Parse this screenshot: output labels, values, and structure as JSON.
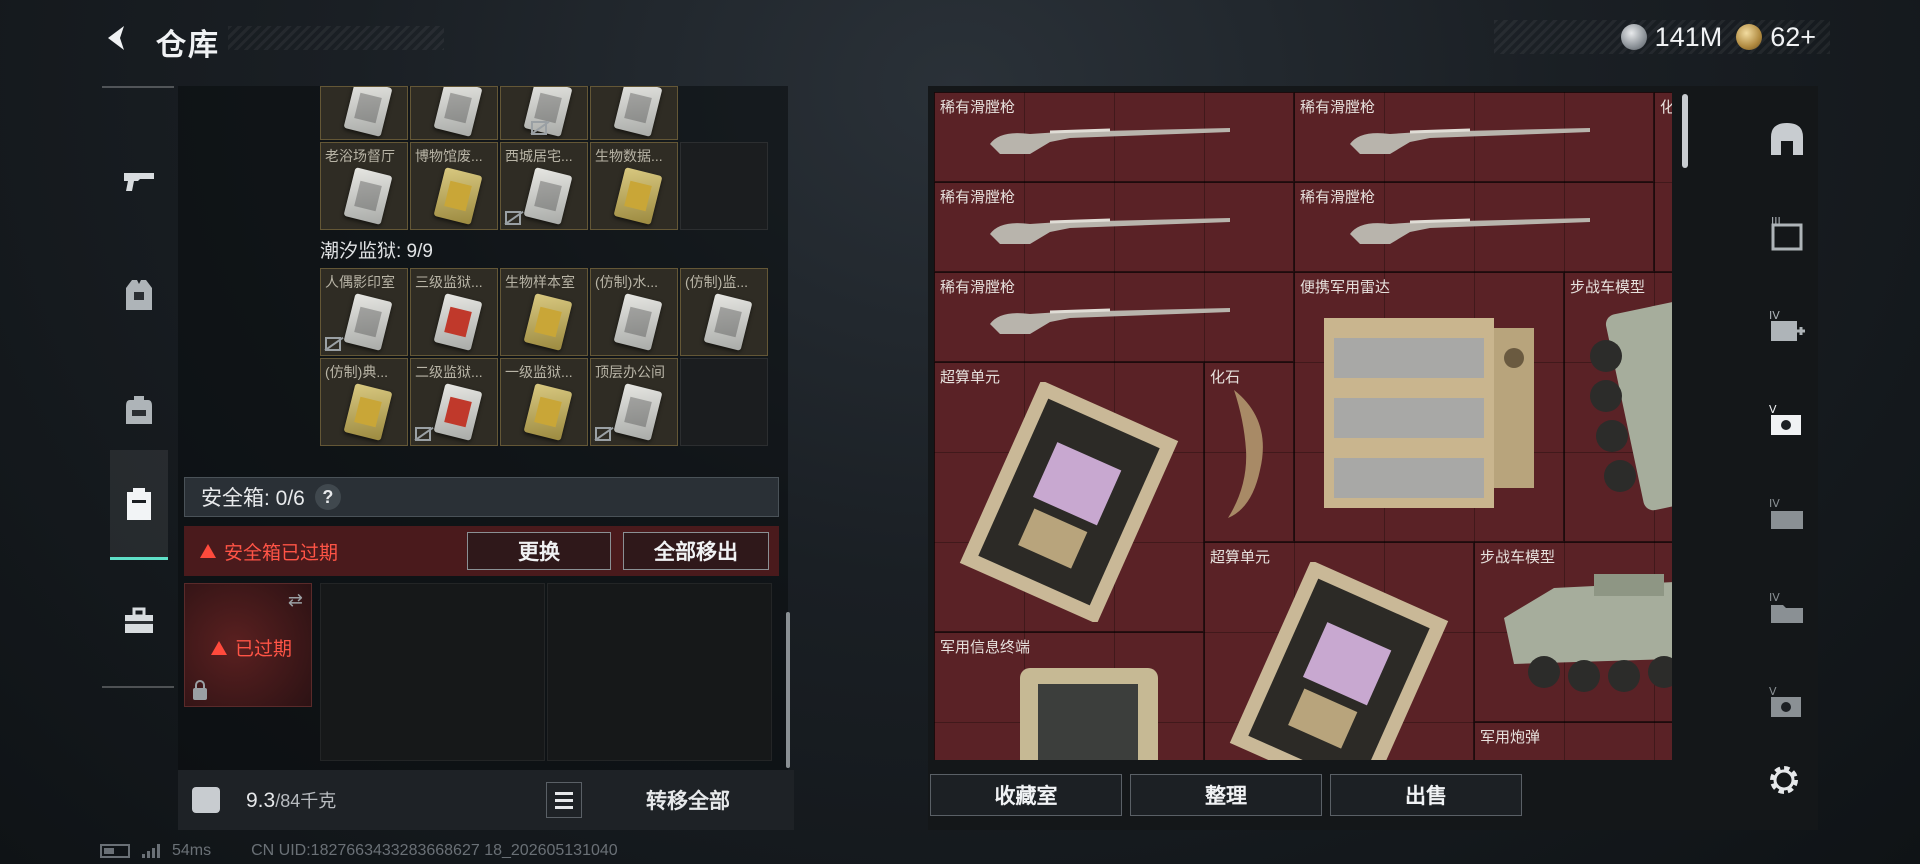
{
  "header": {
    "title": "仓库",
    "currency": [
      {
        "icon": "silver-coin-icon",
        "value": "141M"
      },
      {
        "icon": "gold-coin-icon",
        "value": "62+"
      }
    ]
  },
  "nav": {
    "items": [
      {
        "name": "weapons",
        "icon": "gun-icon"
      },
      {
        "name": "armor",
        "icon": "vest-icon"
      },
      {
        "name": "backpack",
        "icon": "backpack-icon"
      },
      {
        "name": "safe-box",
        "icon": "safebox-icon",
        "active": true
      },
      {
        "name": "toolbox",
        "icon": "toolbox-icon"
      }
    ]
  },
  "inventory": {
    "top_labels": [
      "老浴场督厅",
      "博物馆废...",
      "西城居宅...",
      "生物数据..."
    ],
    "section_title": "潮汐监狱: 9/9",
    "prison_row1": [
      "人偶影印室",
      "三级监狱...",
      "生物样本室",
      "(仿制)水...",
      "(仿制)监..."
    ],
    "prison_row2": [
      "(仿制)典...",
      "二级监狱...",
      "一级监狱...",
      "顶层办公间"
    ]
  },
  "safe_box": {
    "label": "安全箱: 0/6",
    "help": "?",
    "expired_msg": "安全箱已过期",
    "replace_btn": "更换",
    "move_all_btn": "全部移出",
    "item_status": "已过期"
  },
  "footer": {
    "weight_value": "9.3",
    "weight_max": "/84千克",
    "transfer_all": "转移全部"
  },
  "status_bar": {
    "ping": "54ms",
    "uid": "CN UID:1827663433283668627 18_202605131040"
  },
  "storage": {
    "items": [
      {
        "name": "稀有滑膛枪",
        "kind": "musket"
      },
      {
        "name": "稀有滑膛枪",
        "kind": "musket"
      },
      {
        "name": "化石",
        "kind": "fossil"
      },
      {
        "name": "稀有滑膛枪",
        "kind": "musket"
      },
      {
        "name": "稀有滑膛枪",
        "kind": "musket"
      },
      {
        "name": "稀有滑膛枪",
        "kind": "musket"
      },
      {
        "name": "便携军用雷达",
        "kind": "radar"
      },
      {
        "name": "步战车模型",
        "kind": "ifv"
      },
      {
        "name": "超算单元",
        "kind": "chip"
      },
      {
        "name": "化石",
        "kind": "fossil"
      },
      {
        "name": "超算单元",
        "kind": "chip"
      },
      {
        "name": "步战车模型",
        "kind": "ifv"
      },
      {
        "name": "军用信息终端",
        "kind": "terminal"
      },
      {
        "name": "军用炮弹",
        "kind": "shell"
      }
    ],
    "buttons": {
      "collection": "收藏室",
      "sort": "整理",
      "sell": "出售"
    }
  },
  "rail": {
    "items": [
      "container-icon",
      "tier-iii-icon",
      "tier-iv-medical-icon",
      "tier-v-video-icon",
      "tier-iv-card-icon",
      "tier-iv-folder-icon",
      "tier-v-video-icon"
    ]
  },
  "colors": {
    "accent": "#5fe0c8",
    "warning": "#ff5446",
    "storage_bg": "#5a2226"
  }
}
